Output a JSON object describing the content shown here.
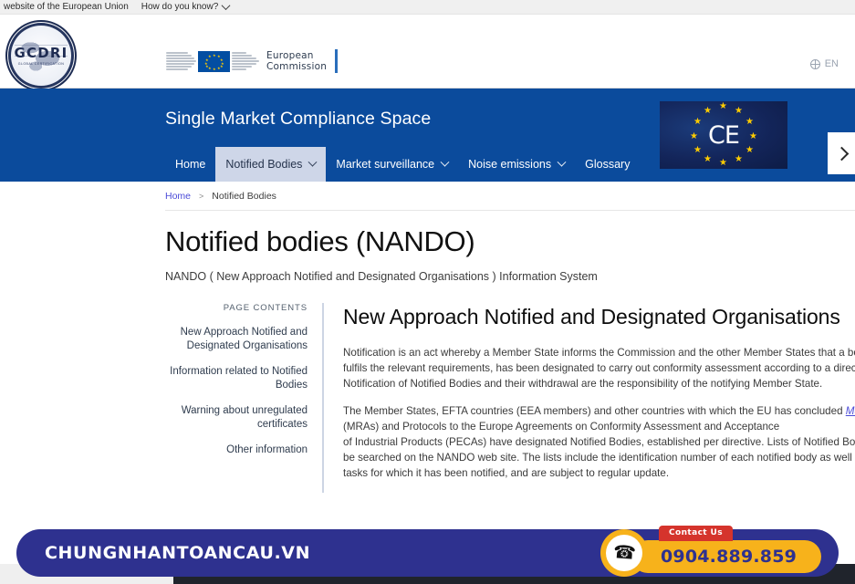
{
  "eu_strip": {
    "notice": "website of the European Union",
    "how_do_you_know": "How do you know?",
    "chevron_icon": "chevron-down-icon"
  },
  "header": {
    "org_logo": {
      "name": "GCDRI",
      "tagline": "GLOBAL CERTIFICATION"
    },
    "ec_logo": {
      "line1": "European",
      "line2": "Commission"
    },
    "language": {
      "code": "EN",
      "icon": "globe-icon"
    }
  },
  "banner": {
    "title": "Single Market Compliance Space",
    "nav": [
      {
        "label": "Home",
        "has_caret": false,
        "active": false
      },
      {
        "label": "Notified Bodies",
        "has_caret": true,
        "active": true
      },
      {
        "label": "Market surveillance",
        "has_caret": true,
        "active": false
      },
      {
        "label": "Noise emissions",
        "has_caret": true,
        "active": false
      },
      {
        "label": "Glossary",
        "has_caret": false,
        "active": false
      }
    ],
    "ce_mark": {
      "letters": "CE",
      "alt": "CE marking with EU stars"
    },
    "next_arrow_icon": "chevron-right-icon",
    "background_color": "#0b4b9c",
    "active_tab_color": "#ced6e8"
  },
  "breadcrumb": {
    "home": "Home",
    "separator": ">",
    "current": "Notified Bodies"
  },
  "page": {
    "title": "Notified bodies (NANDO)",
    "subtitle": "NANDO ( New Approach Notified and Designated Organisations ) Information System"
  },
  "toc": {
    "label": "PAGE CONTENTS",
    "items": [
      "New Approach Notified and Designated Organisations",
      "Information related to Notified Bodies",
      "Warning about unregulated certificates",
      "Other information"
    ]
  },
  "article": {
    "heading": "New Approach Notified and Designated Organisations",
    "paragraph1_lines": [
      "Notification is an act whereby a Member State informs the Commission and the other Member States that a body, which",
      "fulfils the relevant requirements, has been designated to carry out conformity assessment according to a directive.",
      "Notification of Notified Bodies and their withdrawal are the responsibility of the notifying Member State."
    ],
    "paragraph2": {
      "before_link": "The Member States, EFTA countries (EEA members) and other countries with which the EU has concluded ",
      "link_text": "Mutual recognition agreements",
      "after_link_lines": [
        " (MRAs) and Protocols to the Europe Agreements on Conformity Assessment and Acceptance",
        "of Industrial Products (PECAs) have designated Notified Bodies, established per directive. Lists of Notified Bodies can",
        "be searched on the NANDO web site. The lists include the identification number of each notified body as well as the",
        "tasks for which it has been notified, and are subject to regular update."
      ]
    },
    "link_color": "#4b4bd8"
  },
  "watermark": {
    "site": "CHUNGNHANTOANCAU.VN",
    "background_color": "#2e318f",
    "contact": {
      "tab_label": "Contact Us",
      "phone": "0904.889.859",
      "phone_icon": "phone-ringing-icon",
      "pill_color": "#f7b21b",
      "tab_color": "#d5342c"
    }
  }
}
